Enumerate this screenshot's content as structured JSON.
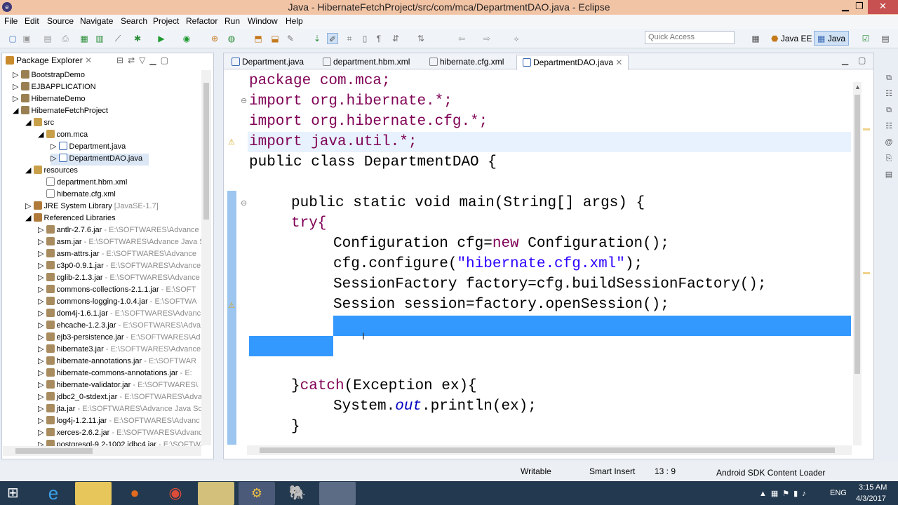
{
  "window": {
    "title": "Java - HibernateFetchProject/src/com/mca/DepartmentDAO.java - Eclipse"
  },
  "menu": [
    "File",
    "Edit",
    "Source",
    "Navigate",
    "Search",
    "Project",
    "Refactor",
    "Run",
    "Window",
    "Help"
  ],
  "toolbar": {
    "quick_access_placeholder": "Quick Access",
    "perspective_javaee": "Java EE",
    "perspective_java": "Java"
  },
  "package_explorer": {
    "title": "Package Explorer",
    "items": [
      {
        "label": "BootstrapDemo",
        "path": ""
      },
      {
        "label": "EJBAPPLICATION",
        "path": ""
      },
      {
        "label": "HibernateDemo",
        "path": ""
      },
      {
        "label": "HibernateFetchProject",
        "path": ""
      },
      {
        "label": "src",
        "path": ""
      },
      {
        "label": "com.mca",
        "path": ""
      },
      {
        "label": "Department.java",
        "path": ""
      },
      {
        "label": "DepartmentDAO.java",
        "path": ""
      },
      {
        "label": "resources",
        "path": ""
      },
      {
        "label": "department.hbm.xml",
        "path": ""
      },
      {
        "label": "hibernate.cfg.xml",
        "path": ""
      },
      {
        "label": "JRE System Library",
        "path": "[JavaSE-1.7]"
      },
      {
        "label": "Referenced Libraries",
        "path": ""
      },
      {
        "label": "antlr-2.7.6.jar",
        "path": " - E:\\SOFTWARES\\Advance"
      },
      {
        "label": "asm.jar",
        "path": " - E:\\SOFTWARES\\Advance Java S"
      },
      {
        "label": "asm-attrs.jar",
        "path": " - E:\\SOFTWARES\\Advance"
      },
      {
        "label": "c3p0-0.9.1.jar",
        "path": " - E:\\SOFTWARES\\Advance"
      },
      {
        "label": "cglib-2.1.3.jar",
        "path": " - E:\\SOFTWARES\\Advance"
      },
      {
        "label": "commons-collections-2.1.1.jar",
        "path": " - E:\\SOFT"
      },
      {
        "label": "commons-logging-1.0.4.jar",
        "path": " - E:\\SOFTWA"
      },
      {
        "label": "dom4j-1.6.1.jar",
        "path": " - E:\\SOFTWARES\\Advanc"
      },
      {
        "label": "ehcache-1.2.3.jar",
        "path": " - E:\\SOFTWARES\\Adva"
      },
      {
        "label": "ejb3-persistence.jar",
        "path": " - E:\\SOFTWARES\\Ad"
      },
      {
        "label": "hibernate3.jar",
        "path": " - E:\\SOFTWARES\\Advance"
      },
      {
        "label": "hibernate-annotations.jar",
        "path": " - E:\\SOFTWAR"
      },
      {
        "label": "hibernate-commons-annotations.jar",
        "path": " - E:"
      },
      {
        "label": "hibernate-validator.jar",
        "path": " - E:\\SOFTWARES\\"
      },
      {
        "label": "jdbc2_0-stdext.jar",
        "path": " - E:\\SOFTWARES\\Adva"
      },
      {
        "label": "jta.jar",
        "path": " - E:\\SOFTWARES\\Advance Java So"
      },
      {
        "label": "log4j-1.2.11.jar",
        "path": " - E:\\SOFTWARES\\Advanc"
      },
      {
        "label": "xerces-2.6.2.jar",
        "path": " - E:\\SOFTWARES\\Advanc"
      },
      {
        "label": "postgresql-9.2-1002.jdbc4.jar",
        "path": " - E:\\SOFTWA"
      }
    ]
  },
  "editor_tabs": [
    "Department.java",
    "department.hbm.xml",
    "hibernate.cfg.xml",
    "DepartmentDAO.java"
  ],
  "code": {
    "l1": "package com.mca;",
    "l2": "import org.hibernate.*;",
    "l3": "import org.hibernate.cfg.*;",
    "l4": "import java.util.*;",
    "l5": "public class DepartmentDAO {",
    "l7": "public static void main(String[] args) {",
    "l8": "try{",
    "l9a": "Configuration cfg=",
    "l9b": "new",
    "l9c": " Configuration();",
    "l10a": "cfg.configure(",
    "l10b": "\"hibernate.cfg.xml\"",
    "l10c": ");",
    "l11": "SessionFactory factory=cfg.buildSessionFactory();",
    "l12": "Session session=factory.openSession();",
    "l15a": "}",
    "l15b": "catch",
    "l15c": "(Exception ex){",
    "l16a": "System.",
    "l16b": "out",
    "l16c": ".println(ex);",
    "l17": "}"
  },
  "status": {
    "writable": "Writable",
    "insert": "Smart Insert",
    "position": "13 : 9",
    "task": "Android SDK Content Loader"
  },
  "taskbar": {
    "lang": "ENG",
    "time": "3:15 AM",
    "date": "4/3/2017"
  }
}
